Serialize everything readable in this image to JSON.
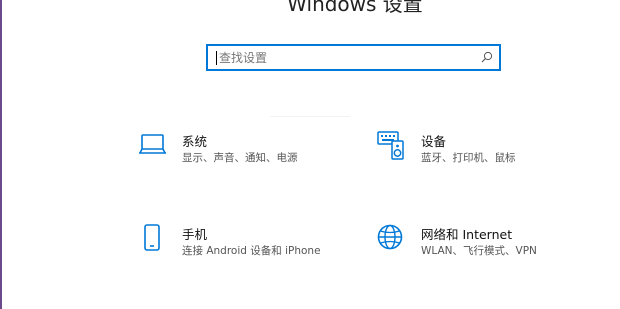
{
  "window": {
    "title": "Windows 设置"
  },
  "search": {
    "placeholder": "查找设置",
    "value": "",
    "icon": "search-icon"
  },
  "tiles": [
    {
      "id": "system",
      "icon": "laptop-icon",
      "title": "系统",
      "description": "显示、声音、通知、电源"
    },
    {
      "id": "devices",
      "icon": "keyboard-speaker-icon",
      "title": "设备",
      "description": "蓝牙、打印机、鼠标"
    },
    {
      "id": "phone",
      "icon": "phone-icon",
      "title": "手机",
      "description": "连接 Android 设备和 iPhone"
    },
    {
      "id": "network",
      "icon": "globe-icon",
      "title": "网络和 Internet",
      "description": "WLAN、飞行模式、VPN"
    }
  ],
  "colors": {
    "accent": "#0078d7",
    "text": "#111111",
    "subtext": "#555555",
    "background": "#ffffff"
  }
}
